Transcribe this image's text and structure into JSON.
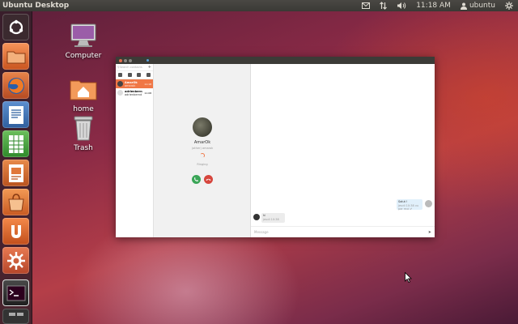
{
  "panel": {
    "title": "Ubuntu Desktop",
    "clock": "11:18 AM",
    "user": "ubuntu",
    "indicators": [
      "mail-icon",
      "network-icon",
      "volume-icon",
      "user-icon",
      "gear-icon"
    ]
  },
  "launcher": {
    "items": [
      "dash-home",
      "files",
      "firefox",
      "libreoffice-writer",
      "libreoffice-calc",
      "libreoffice-impress",
      "software-center",
      "ubuntu-one",
      "system-settings",
      "terminal"
    ]
  },
  "desktop": {
    "icons": [
      {
        "label": "Computer"
      },
      {
        "label": "home"
      },
      {
        "label": "Trash"
      }
    ]
  },
  "app": {
    "search_placeholder": "Search contacts",
    "add_label": "+",
    "contacts": [
      {
        "name": "AmarOk",
        "status": "amarok",
        "time": "11:18"
      },
      {
        "name": "adrienbernd",
        "status": "adrienbernd",
        "time": "11:08"
      }
    ],
    "call": {
      "name": "AmarOk",
      "subtitle": "(other) amarok",
      "status": "Ringing"
    },
    "messages": {
      "outgoing": {
        "text": "Salut !",
        "meta": "jeudi 10:38 vu par moi ✔"
      },
      "incoming": {
        "text": "hi",
        "meta": "jeudi 10:38"
      }
    },
    "composer_placeholder": "Message",
    "colors": {
      "accent": "#f07746",
      "accept": "#3aa557",
      "decline": "#d6463d"
    }
  }
}
